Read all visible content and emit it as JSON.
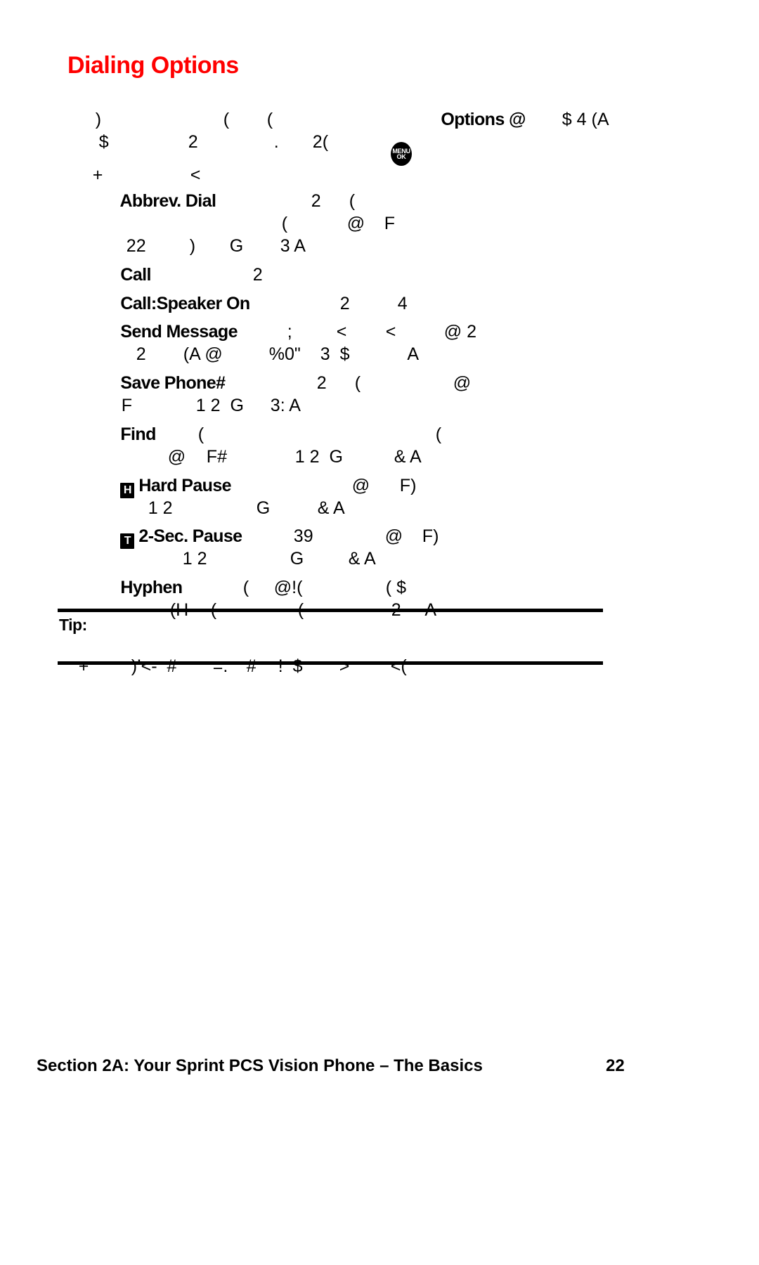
{
  "heading": {
    "title": "Dialing Options"
  },
  "icons": {
    "menu_ok_line1": "MENU",
    "menu_ok_line2": "OK",
    "hard_pause_key": "H",
    "two_sec_pause_key": "T"
  },
  "intro": {
    "line1_a": ")",
    "line1_b": "(",
    "line1_c": "(",
    "line1_d": "Options @",
    "line1_e": "$ 4 (A",
    "line2_a": "$",
    "line2_b": "2",
    "line2_c": ".",
    "line2_d": "2(",
    "line3_a": "+",
    "line3_b": "<"
  },
  "options": [
    {
      "label": "Abbrev. Dial",
      "desc_a": "2",
      "desc_b": "(",
      "cont1_a": "(",
      "cont1_b": "@",
      "cont1_c": "F",
      "cont2_a": "22",
      "cont2_b": ")",
      "cont2_c": "G",
      "cont2_d": "3 A"
    },
    {
      "label": "Call",
      "desc_a": "2"
    },
    {
      "label": "Call:Speaker On",
      "desc_a": "2",
      "desc_b": "4"
    },
    {
      "label": "Send Message",
      "desc_a": ";",
      "desc_b": "<",
      "desc_c": "<",
      "desc_d": "@ 2",
      "cont1_a": "2",
      "cont1_b": "(A @",
      "cont1_c": "%0\"",
      "cont1_d": "3  $",
      "cont1_e": "A"
    },
    {
      "label": "Save Phone#",
      "desc_a": "2",
      "desc_b": "(",
      "desc_c": "@",
      "cont1_a": "F",
      "cont1_b": "1 2  G",
      "cont1_c": "3: A"
    },
    {
      "label": "Find",
      "desc_a": "(",
      "desc_b": "(",
      "cont1_a": "@",
      "cont1_b": "F#",
      "cont1_c": "1 2  G",
      "cont1_d": "& A"
    },
    {
      "label": "Hard Pause",
      "badge": "H",
      "desc_a": "@",
      "desc_b": "F)",
      "cont1_a": "1 2",
      "cont1_b": "G",
      "cont1_c": "& A"
    },
    {
      "label": "2-Sec. Pause",
      "badge": "T",
      "desc_a": "39",
      "desc_b": "@",
      "desc_c": "F)",
      "cont1_a": "1 2",
      "cont1_b": "G",
      "cont1_c": "& A"
    },
    {
      "label": "Hyphen",
      "desc_a": "(",
      "desc_b": "@!(",
      "desc_c": "( $",
      "cont1_a": "(H",
      "cont1_b": "(",
      "cont1_c": "(",
      "cont1_d": "2",
      "cont1_e": "A"
    }
  ],
  "tip": {
    "label": "Tip:",
    "body_a": "+",
    "body_b": ")’<-  #",
    "body_c": "=.",
    "body_d": "#",
    "body_e": "!  $",
    "body_f": ">",
    "body_g": "<("
  },
  "footer": {
    "section": "Section 2A: Your Sprint PCS Vision Phone – The Basics",
    "page_number": "22"
  },
  "colors": {
    "heading": "#ff0000",
    "text": "#000000",
    "background": "#ffffff"
  }
}
